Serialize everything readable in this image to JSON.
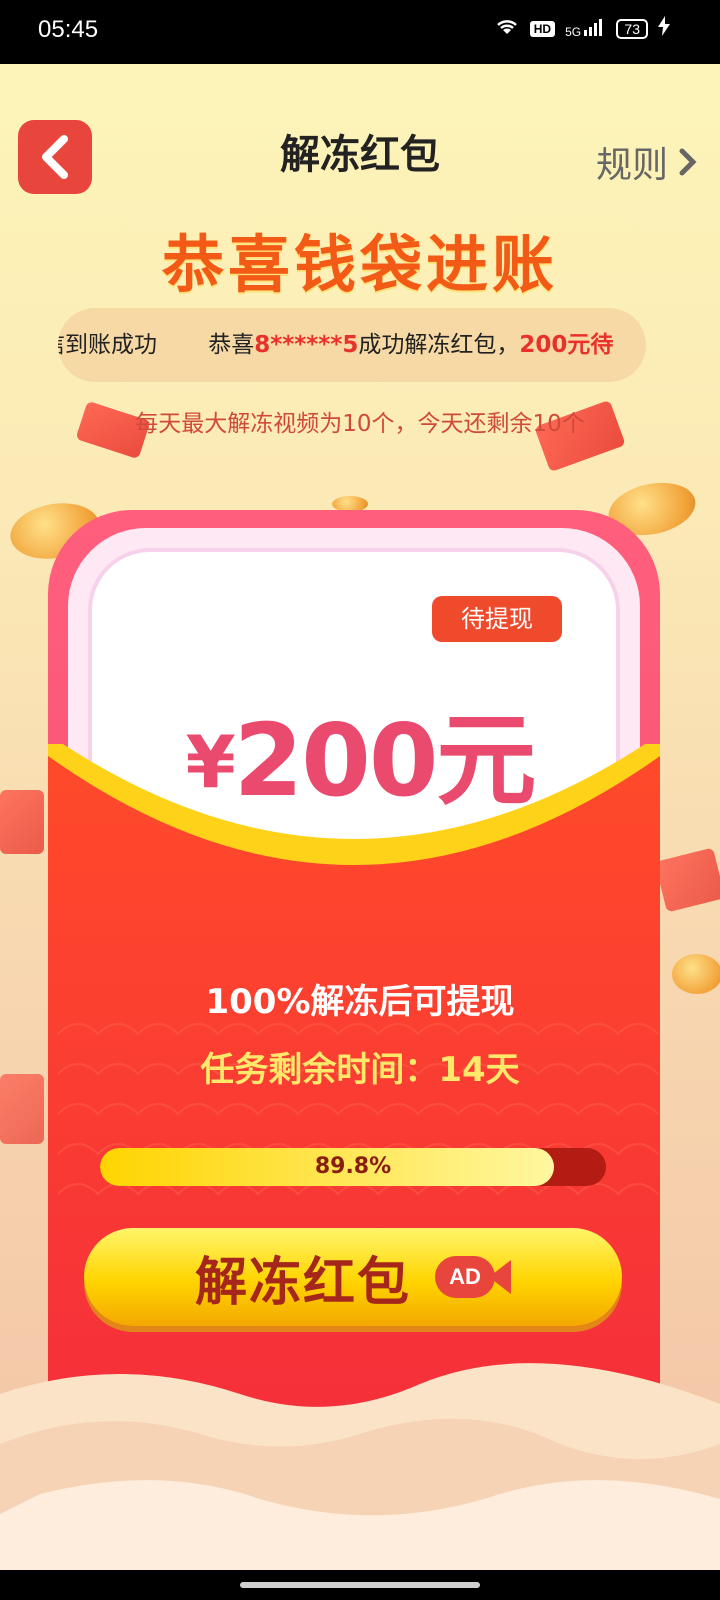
{
  "status_bar": {
    "time": "05:45",
    "icons": [
      "wifi-icon",
      "hd-icon",
      "signal-5g-icon",
      "battery-icon",
      "charging-icon"
    ],
    "hd_label": "HD",
    "network": "5G",
    "battery": "73"
  },
  "header": {
    "back_icon": "chevron-left-icon",
    "title": "解冻红包",
    "rules_label": "规则",
    "rules_icon": "chevron-right-icon"
  },
  "headline": "恭喜钱袋进账",
  "ticker": {
    "prefix": "信到账成功",
    "message_start": "恭喜",
    "masked_user": "8******5",
    "message_mid": "成功解冻红包，",
    "amount": "200元",
    "trailing": "待"
  },
  "hint": "每天最大解冻视频为10个，今天还剩余10个",
  "card": {
    "badge": "待提现",
    "currency": "¥",
    "amount": "200元"
  },
  "info": {
    "unlock_text": "100%解冻后可提现",
    "remaining_text": "任务剩余时间：14天"
  },
  "progress": {
    "value": 0.898,
    "label": "89.8%"
  },
  "unlock_button": {
    "label": "解冻红包",
    "ad_label": "AD",
    "ad_icon": "video-ad-icon"
  },
  "colors": {
    "accent_red": "#e8453c",
    "headline_orange": "#f25a16",
    "amount_pink": "#ea4a6e",
    "button_yellow": "#ffd400"
  }
}
